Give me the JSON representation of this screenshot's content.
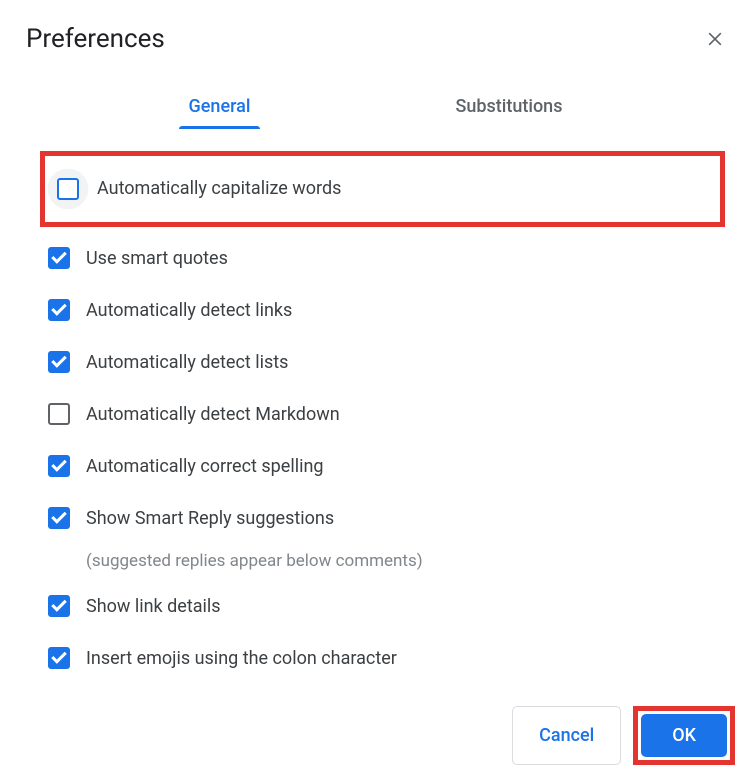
{
  "dialog": {
    "title": "Preferences"
  },
  "tabs": {
    "general": "General",
    "substitutions": "Substitutions"
  },
  "options": [
    {
      "label": "Automatically capitalize words",
      "checked": false,
      "highlighted": true,
      "focused": true
    },
    {
      "label": "Use smart quotes",
      "checked": true
    },
    {
      "label": "Automatically detect links",
      "checked": true
    },
    {
      "label": "Automatically detect lists",
      "checked": true
    },
    {
      "label": "Automatically detect Markdown",
      "checked": false
    },
    {
      "label": "Automatically correct spelling",
      "checked": true
    },
    {
      "label": "Show Smart Reply suggestions",
      "checked": true,
      "sublabel": "(suggested replies appear below comments)"
    },
    {
      "label": "Show link details",
      "checked": true
    },
    {
      "label": "Insert emojis using the colon character",
      "checked": true
    }
  ],
  "buttons": {
    "cancel": "Cancel",
    "ok": "OK"
  }
}
